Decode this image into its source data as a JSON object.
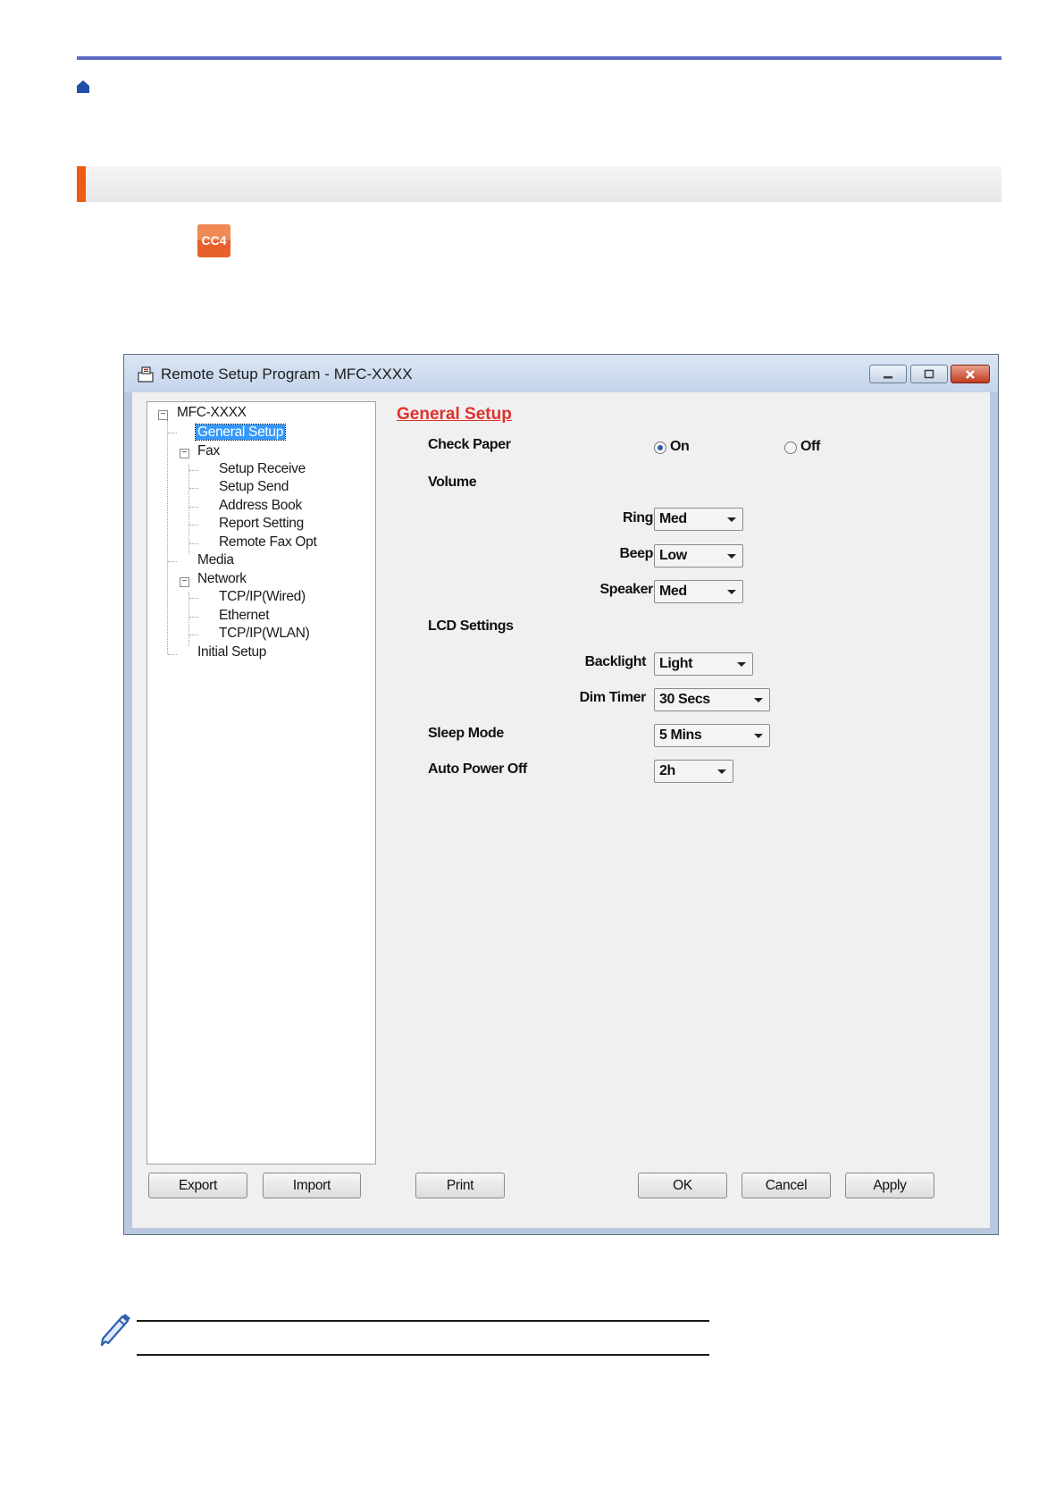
{
  "window": {
    "title": "Remote Setup Program - MFC-XXXX",
    "controls": [
      "minimize",
      "maximize",
      "close"
    ]
  },
  "tree": {
    "root": "MFC-XXXX",
    "items": [
      {
        "label": "General Setup",
        "selected": true
      },
      {
        "label": "Fax"
      },
      {
        "label": "Setup Receive"
      },
      {
        "label": "Setup Send"
      },
      {
        "label": "Address Book"
      },
      {
        "label": "Report Setting"
      },
      {
        "label": "Remote Fax Opt"
      },
      {
        "label": "Media"
      },
      {
        "label": "Network"
      },
      {
        "label": "TCP/IP(Wired)"
      },
      {
        "label": "Ethernet"
      },
      {
        "label": "TCP/IP(WLAN)"
      },
      {
        "label": "Initial Setup"
      }
    ]
  },
  "settings": {
    "title": "General Setup",
    "check_paper": {
      "label": "Check Paper",
      "options": [
        "On",
        "Off"
      ],
      "selected": "On"
    },
    "volume": {
      "label": "Volume",
      "ring": {
        "label": "Ring",
        "value": "Med"
      },
      "beep": {
        "label": "Beep",
        "value": "Low"
      },
      "speaker": {
        "label": "Speaker",
        "value": "Med"
      }
    },
    "lcd": {
      "label": "LCD Settings",
      "backlight": {
        "label": "Backlight",
        "value": "Light"
      },
      "dim_timer": {
        "label": "Dim Timer",
        "value": "30 Secs"
      }
    },
    "sleep_mode": {
      "label": "Sleep Mode",
      "value": "5 Mins"
    },
    "auto_power_off": {
      "label": "Auto Power Off",
      "value": "2h"
    }
  },
  "buttons": {
    "export": "Export",
    "import": "Import",
    "print": "Print",
    "ok": "OK",
    "cancel": "Cancel",
    "apply": "Apply"
  },
  "icons": {
    "home": "home-icon",
    "app": "cc4-icon",
    "note": "pencil-icon"
  },
  "colors": {
    "top_rule": "#5b6bc4",
    "section_accent": "#f05a12",
    "settings_title": "#e0322b",
    "selection": "#3399ff"
  }
}
